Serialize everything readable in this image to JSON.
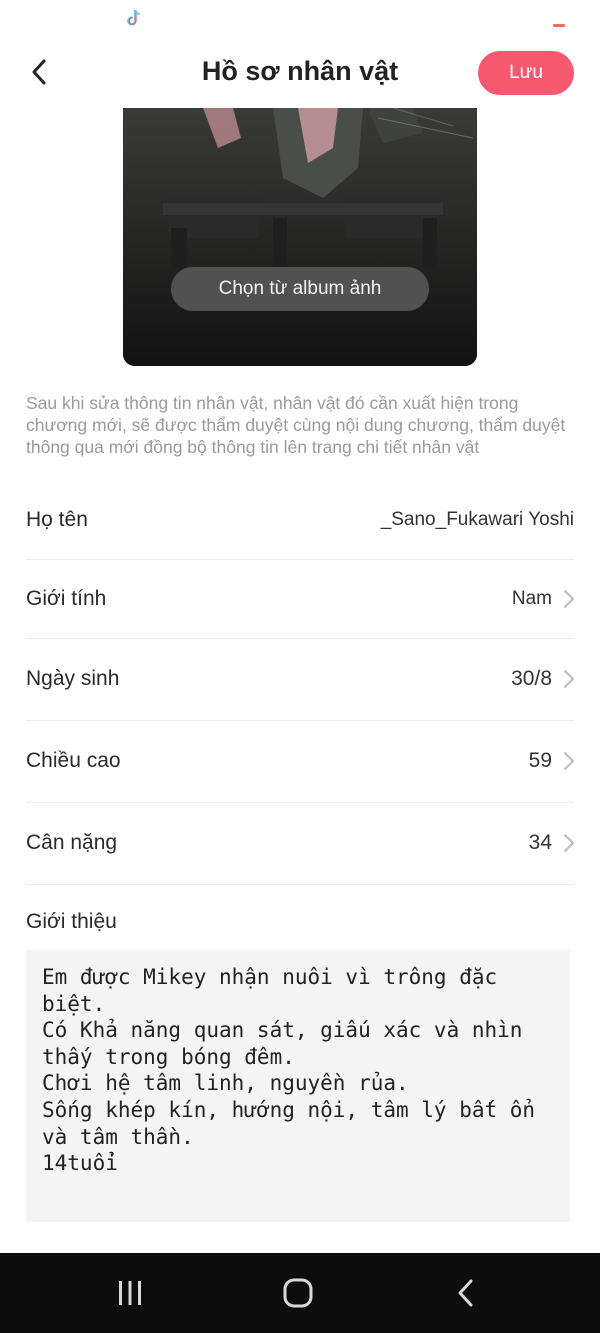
{
  "header": {
    "title": "Hồ sơ nhân vật",
    "save_label": "Lưu"
  },
  "avatar": {
    "album_button_label": "Chọn từ album ảnh"
  },
  "notice": "Sau khi sửa thông tin nhân vật, nhân vật đó cần xuất hiện trong chương mới, sẽ được thẩm duyệt cùng nội dung chương, thẩm duyệt thông qua mới đồng bộ thông tin lên trang chi tiết nhân vật",
  "fields": {
    "name": {
      "label": "Họ tên",
      "value": "_Sano_Fukawari Yoshi"
    },
    "gender": {
      "label": "Giới tính",
      "value": "Nam"
    },
    "birthday": {
      "label": "Ngày sinh",
      "value": "30/8"
    },
    "height": {
      "label": "Chiều cao",
      "value": "59"
    },
    "weight": {
      "label": "Cân nặng",
      "value": "34"
    }
  },
  "intro": {
    "label": "Giới thiệu",
    "text": "Em được Mikey nhận nuôi vì trông đặc biệt.\nCó Khả năng quan sát, giấu xác và nhìn thấy trong bóng đêm.\nChơi hệ tâm linh, nguyền rủa.\nSống khép kín, hướng nội, tâm lý bất ổn và tâm thần.\n14tuổi"
  },
  "colors": {
    "accent": "#f6586f",
    "background": "#ffffff",
    "navbar": "#0d0d0d"
  }
}
